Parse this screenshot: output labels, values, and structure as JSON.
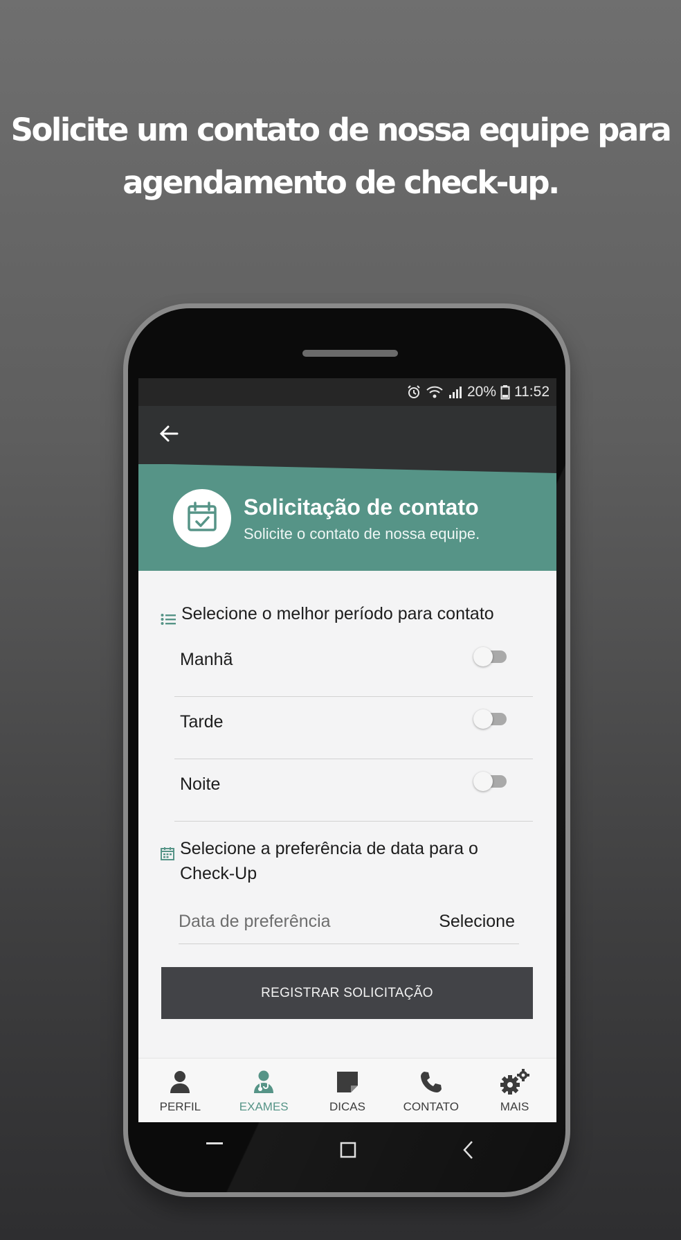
{
  "headline": {
    "line1": "Solicite um contato de nossa equipe para",
    "line2": "agendamento de check-up."
  },
  "status_bar": {
    "battery": "20%",
    "time": "11:52",
    "icons": [
      "alarm-icon",
      "wifi-icon",
      "signal-icon",
      "battery-icon"
    ]
  },
  "app_bar": {
    "back_icon": "arrow-left-icon"
  },
  "header": {
    "icon": "calendar-check-icon",
    "title": "Solicitação de contato",
    "subtitle": "Solicite o contato de nossa equipe."
  },
  "period_section": {
    "icon": "list-icon",
    "title": "Selecione o melhor período para contato",
    "options": [
      {
        "label": "Manhã",
        "on": false
      },
      {
        "label": "Tarde",
        "on": false
      },
      {
        "label": "Noite",
        "on": false
      }
    ]
  },
  "date_section": {
    "icon": "calendar-icon",
    "title_line1": "Selecione a preferência de data para o",
    "title_line2": "Check-Up",
    "placeholder": "Data de preferência",
    "select_label": "Selecione"
  },
  "submit_label": "REGISTRAR SOLICITAÇÃO",
  "tabs": [
    {
      "label": "PERFIL",
      "icon": "person-icon",
      "active": false
    },
    {
      "label": "EXAMES",
      "icon": "doctor-icon",
      "active": true
    },
    {
      "label": "DICAS",
      "icon": "note-icon",
      "active": false
    },
    {
      "label": "CONTATO",
      "icon": "phone-icon",
      "active": false
    },
    {
      "label": "MAIS",
      "icon": "gears-icon",
      "active": false
    }
  ],
  "colors": {
    "accent": "#569487",
    "app_bar": "#303233",
    "button": "#424347"
  }
}
